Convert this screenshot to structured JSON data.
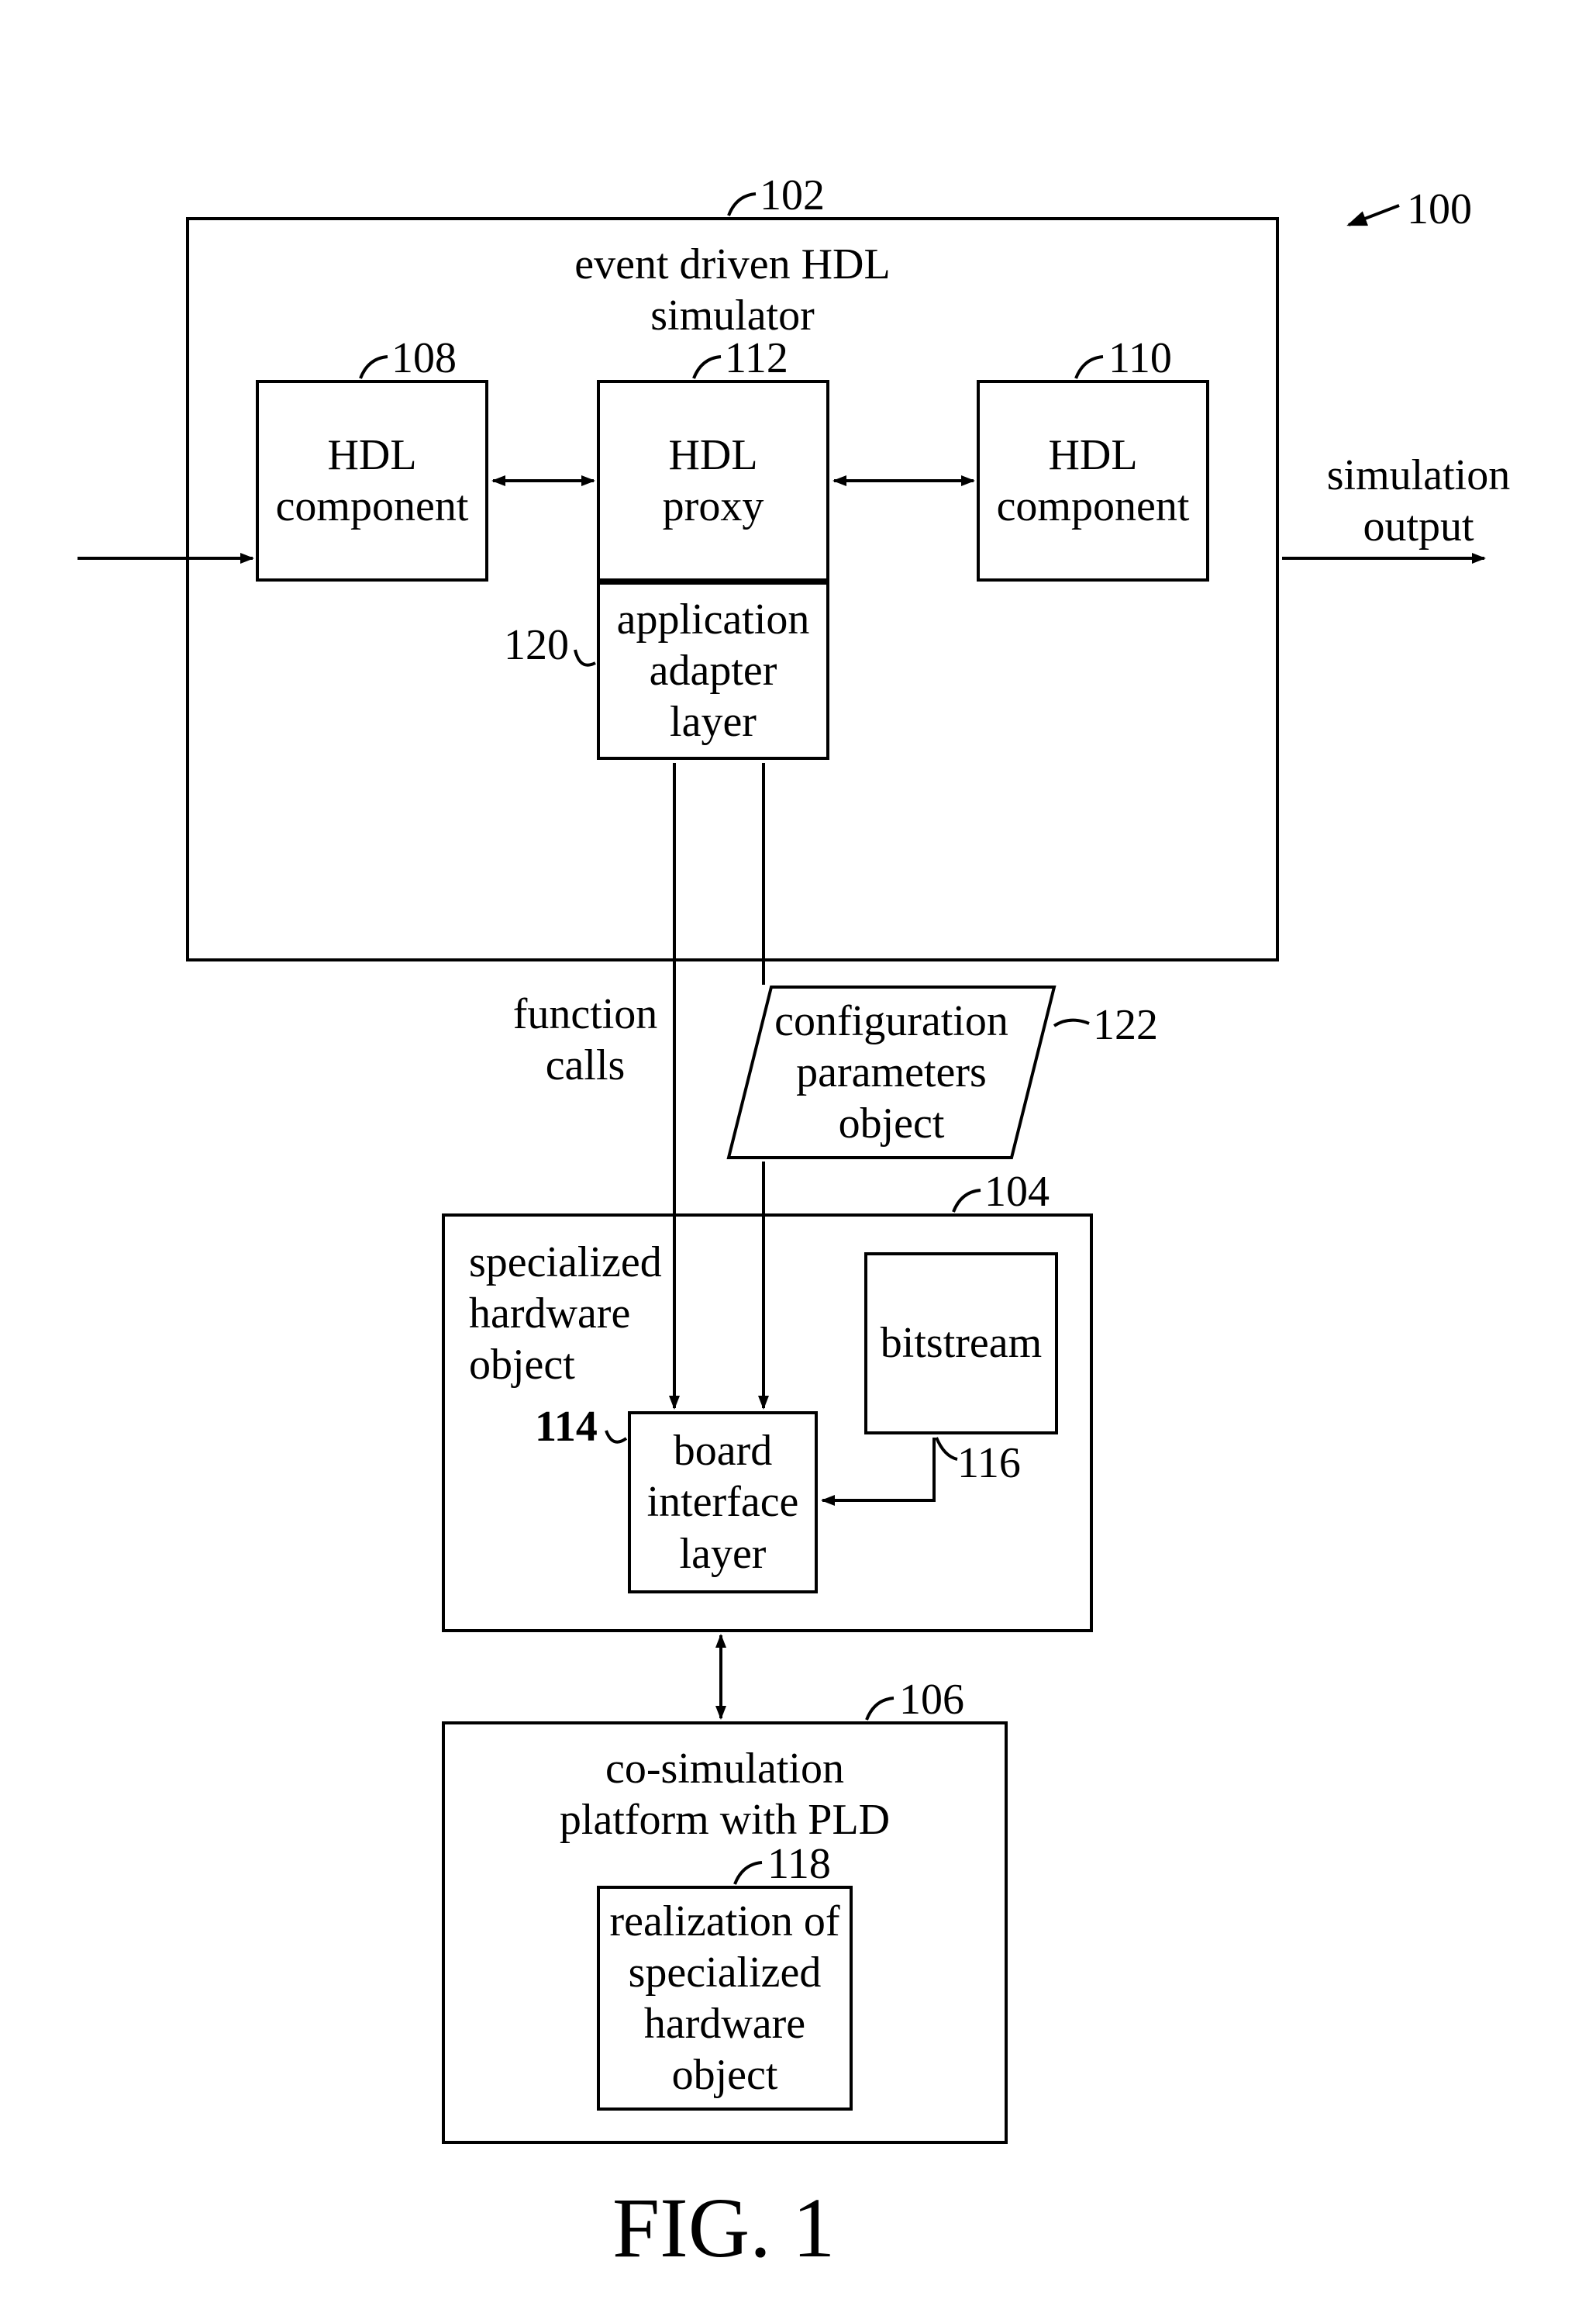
{
  "figure_caption": "FIG. 1",
  "refs": {
    "r100": "100",
    "r102": "102",
    "r104": "104",
    "r106": "106",
    "r108": "108",
    "r110": "110",
    "r112": "112",
    "r114": "114",
    "r116": "116",
    "r118": "118",
    "r120": "120",
    "r122": "122"
  },
  "blocks": {
    "simulator_title_l1": "event driven HDL",
    "simulator_title_l2": "simulator",
    "hdl_component_l1": "HDL",
    "hdl_component_l2": "component",
    "hdl_proxy_l1": "HDL",
    "hdl_proxy_l2": "proxy",
    "app_adapter_l1": "application",
    "app_adapter_l2": "adapter",
    "app_adapter_l3": "layer",
    "func_calls_l1": "function",
    "func_calls_l2": "calls",
    "config_l1": "configuration",
    "config_l2": "parameters",
    "config_l3": "object",
    "sho_l1": "specialized",
    "sho_l2": "hardware",
    "sho_l3": "object",
    "bitstream": "bitstream",
    "bil_l1": "board",
    "bil_l2": "interface",
    "bil_l3": "layer",
    "cosim_l1": "co-simulation",
    "cosim_l2": "platform with PLD",
    "realize_l1": "realization of",
    "realize_l2": "specialized",
    "realize_l3": "hardware",
    "realize_l4": "object",
    "sim_out_l1": "simulation",
    "sim_out_l2": "output"
  }
}
